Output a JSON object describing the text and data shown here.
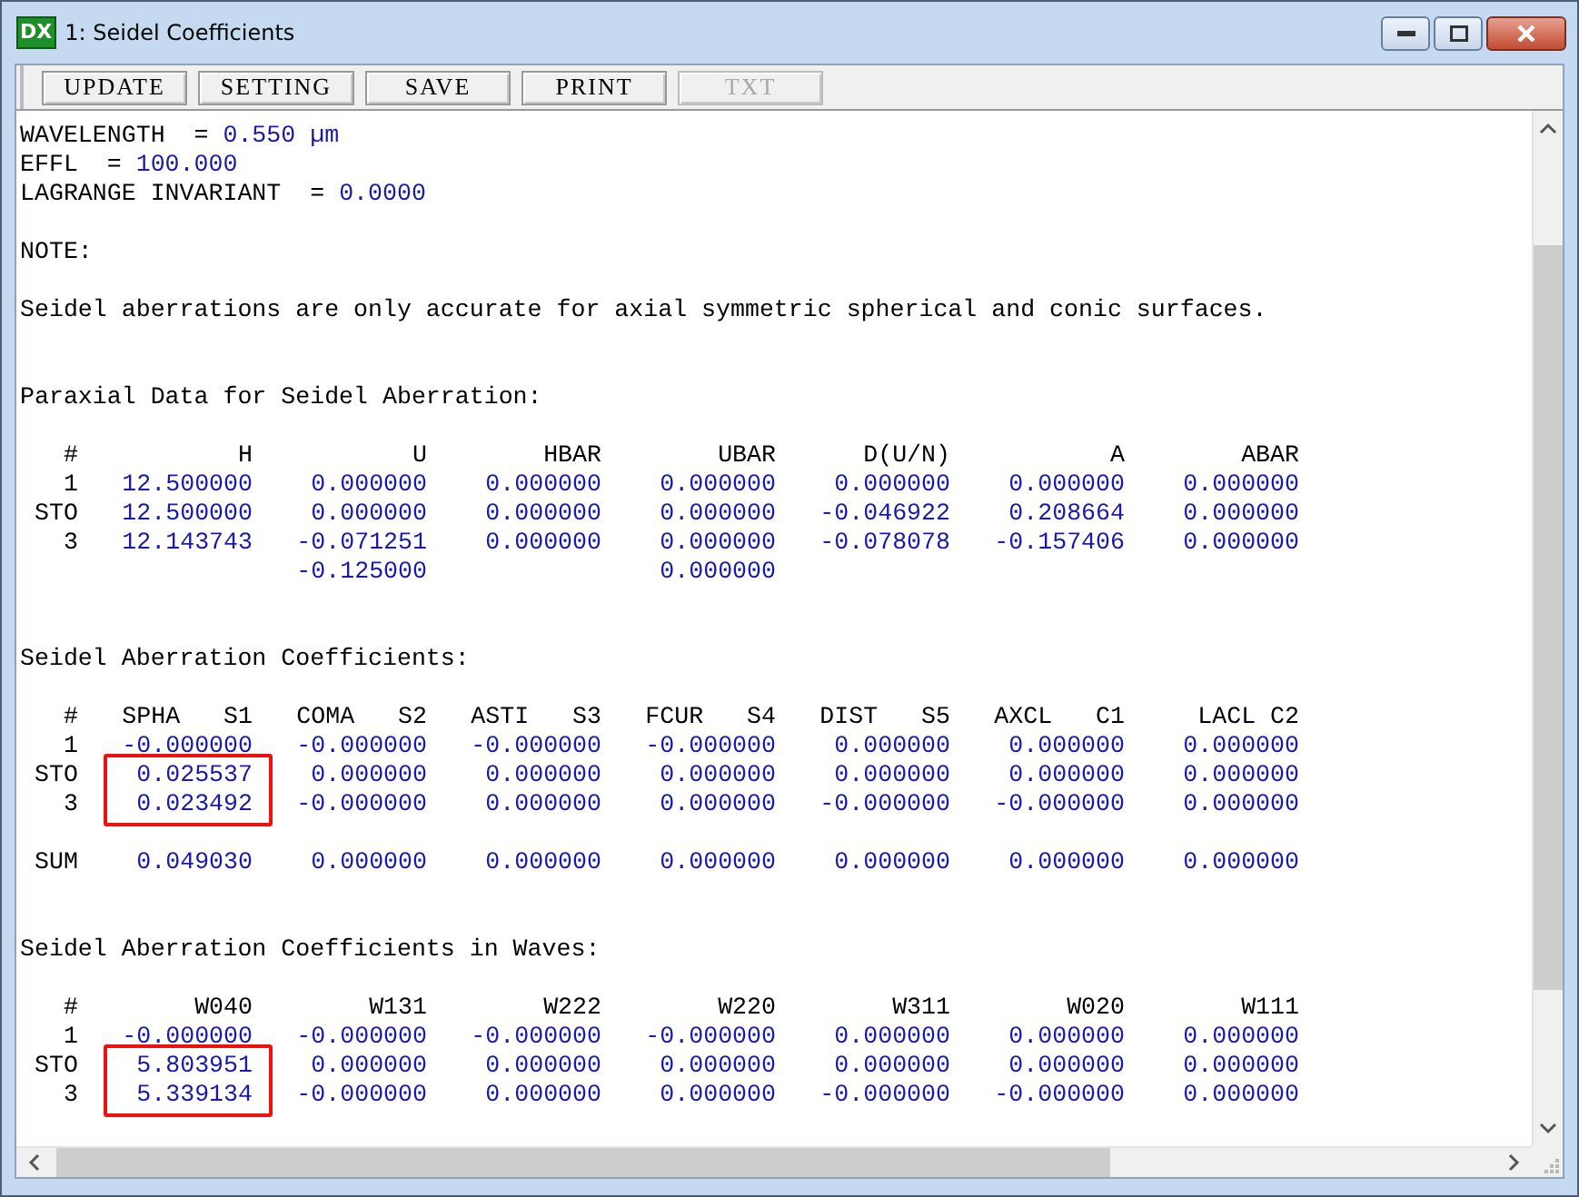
{
  "window": {
    "title": "1: Seidel Coefficients",
    "app_icon_text": "DX"
  },
  "toolbar": [
    {
      "label": "UPDATE",
      "disabled": false
    },
    {
      "label": "SETTING",
      "disabled": false
    },
    {
      "label": "SAVE",
      "disabled": false
    },
    {
      "label": "PRINT",
      "disabled": false
    },
    {
      "label": "TXT",
      "disabled": true
    }
  ],
  "header_lines": [
    {
      "label": "WAVELENGTH  =",
      "value": "0.550 µm"
    },
    {
      "label": "EFFL  =",
      "value": "100.000"
    },
    {
      "label": "LAGRANGE INVARIANT  =",
      "value": "0.0000"
    }
  ],
  "note": {
    "label": "NOTE:",
    "text": "Seidel aberrations are only accurate for axial symmetric spherical and conic surfaces."
  },
  "tables": [
    {
      "title": "Paraxial Data for Seidel Aberration:",
      "columns": [
        "#",
        "H",
        "U",
        "HBAR",
        "UBAR",
        "D(U/N)",
        "A",
        "ABAR"
      ],
      "rows": [
        {
          "kind": "surface",
          "label": "1",
          "highlighted": false,
          "values": [
            "12.500000",
            "0.000000",
            "0.000000",
            "0.000000",
            "0.000000",
            "0.000000",
            "0.000000"
          ]
        },
        {
          "kind": "surface",
          "label": "STO",
          "highlighted": false,
          "values": [
            "12.500000",
            "0.000000",
            "0.000000",
            "0.000000",
            "-0.046922",
            "0.208664",
            "0.000000"
          ]
        },
        {
          "kind": "surface",
          "label": "3",
          "highlighted": false,
          "values": [
            "12.143743",
            "-0.071251",
            "0.000000",
            "0.000000",
            "-0.078078",
            "-0.157406",
            "0.000000"
          ]
        },
        {
          "kind": "continuation",
          "u_value": "-0.125000",
          "ubar_value": "0.000000"
        }
      ]
    },
    {
      "title": "Seidel Aberration Coefficients:",
      "columns": [
        "#",
        "SPHA   S1",
        "COMA   S2",
        "ASTI   S3",
        "FCUR   S4",
        "DIST   S5",
        "AXCL   C1",
        "LACL C2"
      ],
      "rows": [
        {
          "kind": "surface",
          "label": "1",
          "highlighted": false,
          "values": [
            "-0.000000",
            "-0.000000",
            "-0.000000",
            "-0.000000",
            "0.000000",
            "0.000000",
            "0.000000"
          ]
        },
        {
          "kind": "surface",
          "label": "STO",
          "highlighted": true,
          "values": [
            "0.025537",
            "0.000000",
            "0.000000",
            "0.000000",
            "0.000000",
            "0.000000",
            "0.000000"
          ]
        },
        {
          "kind": "surface",
          "label": "3",
          "highlighted": true,
          "values": [
            "0.023492",
            "-0.000000",
            "0.000000",
            "0.000000",
            "-0.000000",
            "-0.000000",
            "0.000000"
          ]
        },
        {
          "kind": "sum",
          "label": "SUM",
          "highlighted": false,
          "values": [
            "0.049030",
            "0.000000",
            "0.000000",
            "0.000000",
            "0.000000",
            "0.000000",
            "0.000000"
          ]
        }
      ]
    },
    {
      "title": "Seidel Aberration Coefficients in Waves:",
      "columns": [
        "#",
        "W040",
        "W131",
        "W222",
        "W220",
        "W311",
        "W020",
        "W111"
      ],
      "rows": [
        {
          "kind": "surface",
          "label": "1",
          "highlighted": false,
          "values": [
            "-0.000000",
            "-0.000000",
            "-0.000000",
            "-0.000000",
            "0.000000",
            "0.000000",
            "0.000000"
          ]
        },
        {
          "kind": "surface",
          "label": "STO",
          "highlighted": true,
          "values": [
            "5.803951",
            "0.000000",
            "0.000000",
            "0.000000",
            "0.000000",
            "0.000000",
            "0.000000"
          ]
        },
        {
          "kind": "surface",
          "label": "3",
          "highlighted": true,
          "values": [
            "5.339134",
            "-0.000000",
            "0.000000",
            "0.000000",
            "-0.000000",
            "-0.000000",
            "0.000000"
          ]
        }
      ]
    }
  ]
}
